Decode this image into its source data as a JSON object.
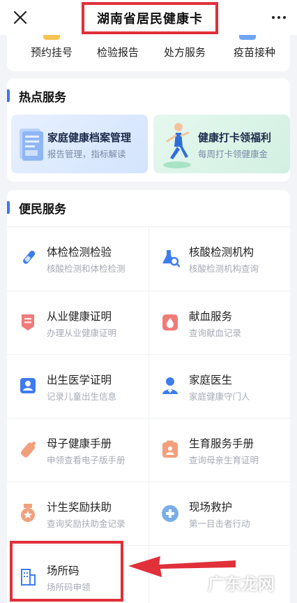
{
  "header": {
    "title": "湖南省居民健康卡"
  },
  "quick_actions": [
    {
      "label": "预约挂号",
      "icon": "calendar-icon"
    },
    {
      "label": "检验报告",
      "icon": "report-icon"
    },
    {
      "label": "处方服务",
      "icon": "prescription-icon"
    },
    {
      "label": "疫苗接种",
      "icon": "vaccine-icon"
    }
  ],
  "hot_services": {
    "title": "热点服务",
    "items": [
      {
        "title": "家庭健康档案管理",
        "subtitle": "报告管理，指标解读",
        "icon": "health-record-illustration"
      },
      {
        "title": "健康打卡领福利",
        "subtitle": "每周打卡领健康金",
        "icon": "runner-illustration"
      }
    ]
  },
  "convenience_services": {
    "title": "便民服务",
    "items": [
      {
        "name": "体检检测检验",
        "desc": "核酸检测和体检检测",
        "icon": "test-tube-icon",
        "color": "#3d7cf0"
      },
      {
        "name": "核酸检测机构",
        "desc": "核酸检测机构查询",
        "icon": "lab-search-icon",
        "color": "#3d7cf0"
      },
      {
        "name": "从业健康证明",
        "desc": "办理从业健康证明",
        "icon": "certificate-icon",
        "color": "#ef7b78"
      },
      {
        "name": "献血服务",
        "desc": "查询献血记录",
        "icon": "blood-drop-icon",
        "color": "#ef7b78"
      },
      {
        "name": "出生医学证明",
        "desc": "记录儿童出生信息",
        "icon": "birth-certificate-icon",
        "color": "#3d7cf0"
      },
      {
        "name": "家庭医生",
        "desc": "家庭健康守门人",
        "icon": "doctor-icon",
        "color": "#3d7cf0"
      },
      {
        "name": "母子健康手册",
        "desc": "申领查看电子版手册",
        "icon": "baby-bottle-icon",
        "color": "#f2a07c"
      },
      {
        "name": "生育服务手册",
        "desc": "查询母亲生育证明",
        "icon": "maternity-handbook-icon",
        "color": "#f2a07c"
      },
      {
        "name": "计生奖励扶助",
        "desc": "查询奖励扶助金记录",
        "icon": "award-medal-icon",
        "color": "#f2a07c"
      },
      {
        "name": "现场救护",
        "desc": "第一目击者行动",
        "icon": "first-aid-icon",
        "color": "#7aaee8"
      },
      {
        "name": "场所码",
        "desc": "场所码申领",
        "icon": "building-icon",
        "color": "#3d7cf0"
      }
    ]
  },
  "watermark": "广东龙网"
}
